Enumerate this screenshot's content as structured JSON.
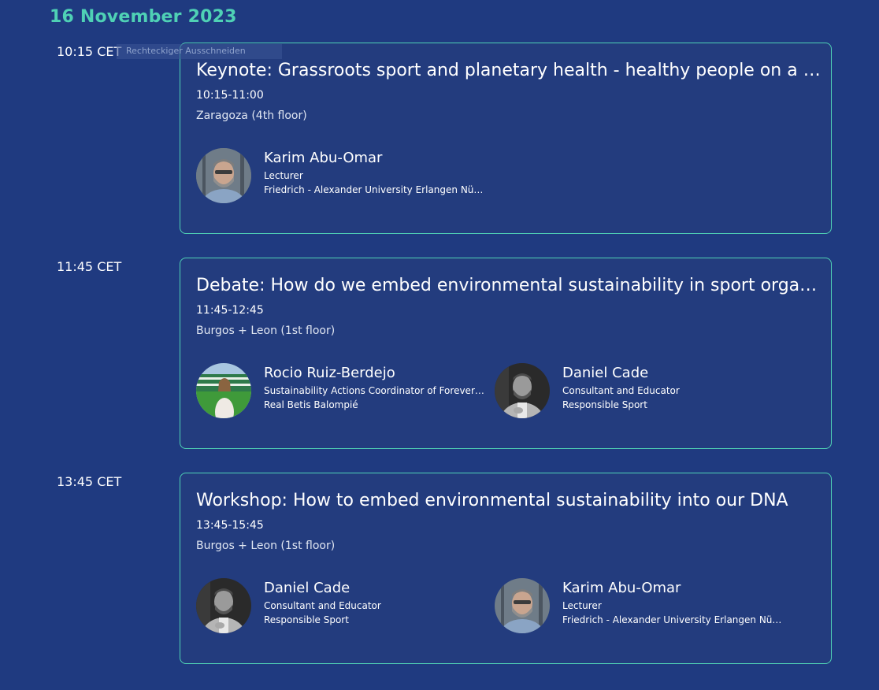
{
  "schedule": {
    "date": "16 November 2023",
    "tooltip": "Rechteckiger Ausschneiden",
    "sessions": [
      {
        "time_label": "10:15 CET",
        "title": "Keynote: Grassroots sport and planetary health - healthy people on a sick planet?",
        "time_range": "10:15-11:00",
        "room": "Zaragoza (4th floor)",
        "speakers": [
          {
            "name": "Karim Abu-Omar",
            "role": "Lecturer",
            "org": "Friedrich - Alexander University Erlangen Nürnberg"
          }
        ]
      },
      {
        "time_label": "11:45 CET",
        "title": "Debate: How do we embed environmental sustainability in sport organisations?",
        "time_range": "11:45-12:45",
        "room": "Burgos + Leon (1st floor)",
        "speakers": [
          {
            "name": "Rocio Ruiz-Berdejo",
            "role": "Sustainability Actions Coordinator of Forever Green",
            "org": "Real Betis Balompié"
          },
          {
            "name": "Daniel Cade",
            "role": "Consultant and Educator",
            "org": "Responsible Sport"
          }
        ]
      },
      {
        "time_label": "13:45 CET",
        "title": "Workshop: How to embed environmental sustainability into our DNA",
        "time_range": "13:45-15:45",
        "room": "Burgos + Leon (1st floor)",
        "speakers": [
          {
            "name": "Daniel Cade",
            "role": "Consultant and Educator",
            "org": "Responsible Sport"
          },
          {
            "name": "Karim Abu-Omar",
            "role": "Lecturer",
            "org": "Friedrich - Alexander University Erlangen Nürnberg"
          }
        ]
      }
    ]
  },
  "colors": {
    "background": "#1f3a80",
    "accent": "#4fd1b5",
    "card": "#233c7e"
  }
}
